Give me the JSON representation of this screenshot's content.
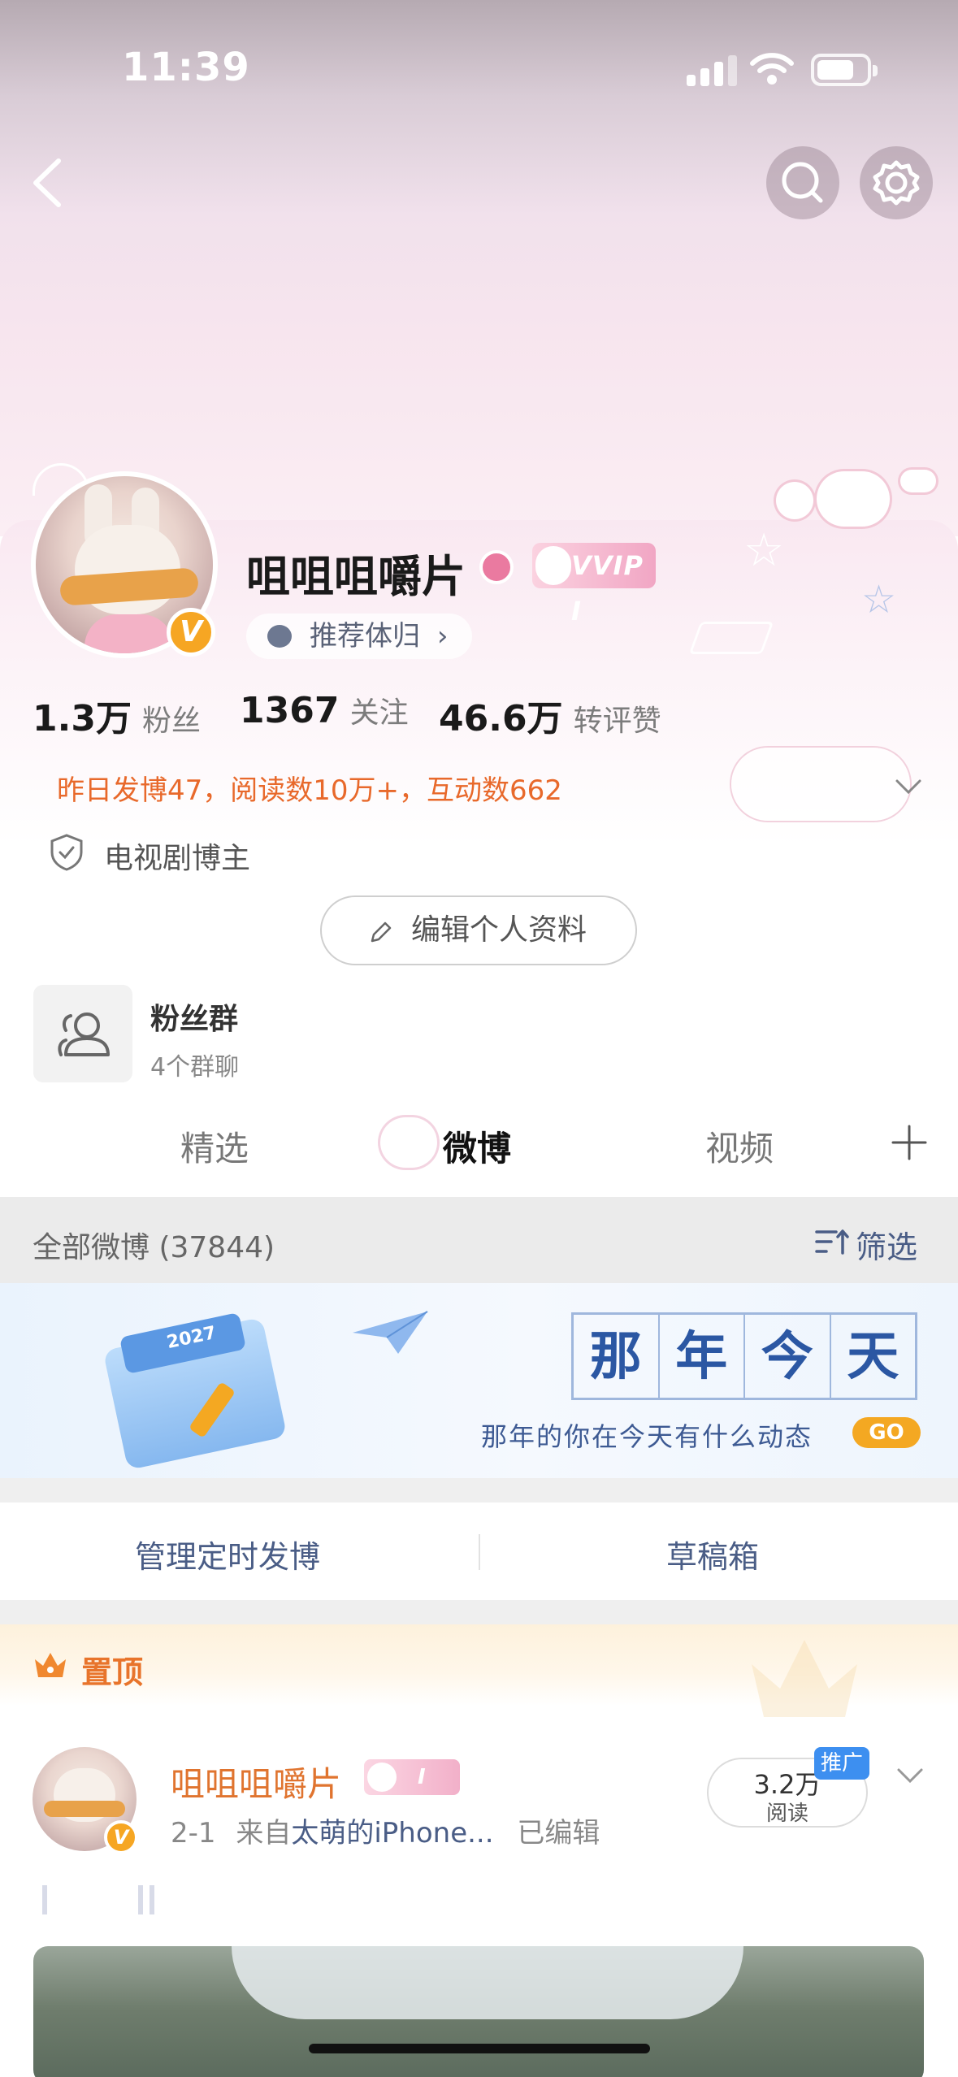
{
  "status_bar": {
    "time": "11:39"
  },
  "profile": {
    "username": "咀咀咀嚼片",
    "vvip_badge": "VVIP I",
    "tag": "推荐体归",
    "tag_chevron": "›",
    "v_badge": "V",
    "stats": [
      {
        "value": "1.3万",
        "label": "粉丝"
      },
      {
        "value": "1367",
        "label": "关注"
      },
      {
        "value": "46.6万",
        "label": "转评赞"
      }
    ],
    "activity": "昨日发博47，阅读数10万+，互动数662",
    "category": "电视剧博主",
    "edit_button": "编辑个人资料"
  },
  "fan_group": {
    "title": "粉丝群",
    "subtitle": "4个群聊"
  },
  "tabs": [
    {
      "label": "精选",
      "active": false
    },
    {
      "label": "微博",
      "active": true
    },
    {
      "label": "视频",
      "active": false
    }
  ],
  "filter_bar": {
    "all_label": "全部微博 (37844)",
    "filter_label": "筛选"
  },
  "banner": {
    "calendar_year": "2027",
    "title_chars": [
      "那",
      "年",
      "今",
      "天"
    ],
    "caption": "那年的你在今天有什么动态",
    "go": "GO"
  },
  "manage": {
    "scheduled": "管理定时发博",
    "drafts": "草稿箱"
  },
  "pinned": {
    "label": "置顶"
  },
  "post": {
    "author": "咀咀咀嚼片",
    "badge": "I",
    "v_badge": "V",
    "date": "2-1",
    "from_prefix": "来自",
    "source": "太萌的iPhone...",
    "edited": "已编辑",
    "reads": "3.2万",
    "reads_label": "阅读",
    "promo_tag": "推广"
  },
  "colors": {
    "accent_orange": "#e8692b",
    "link_blue": "#4a5d86",
    "vip_gold": "#f6a623",
    "promo_blue": "#3d8ff0"
  }
}
